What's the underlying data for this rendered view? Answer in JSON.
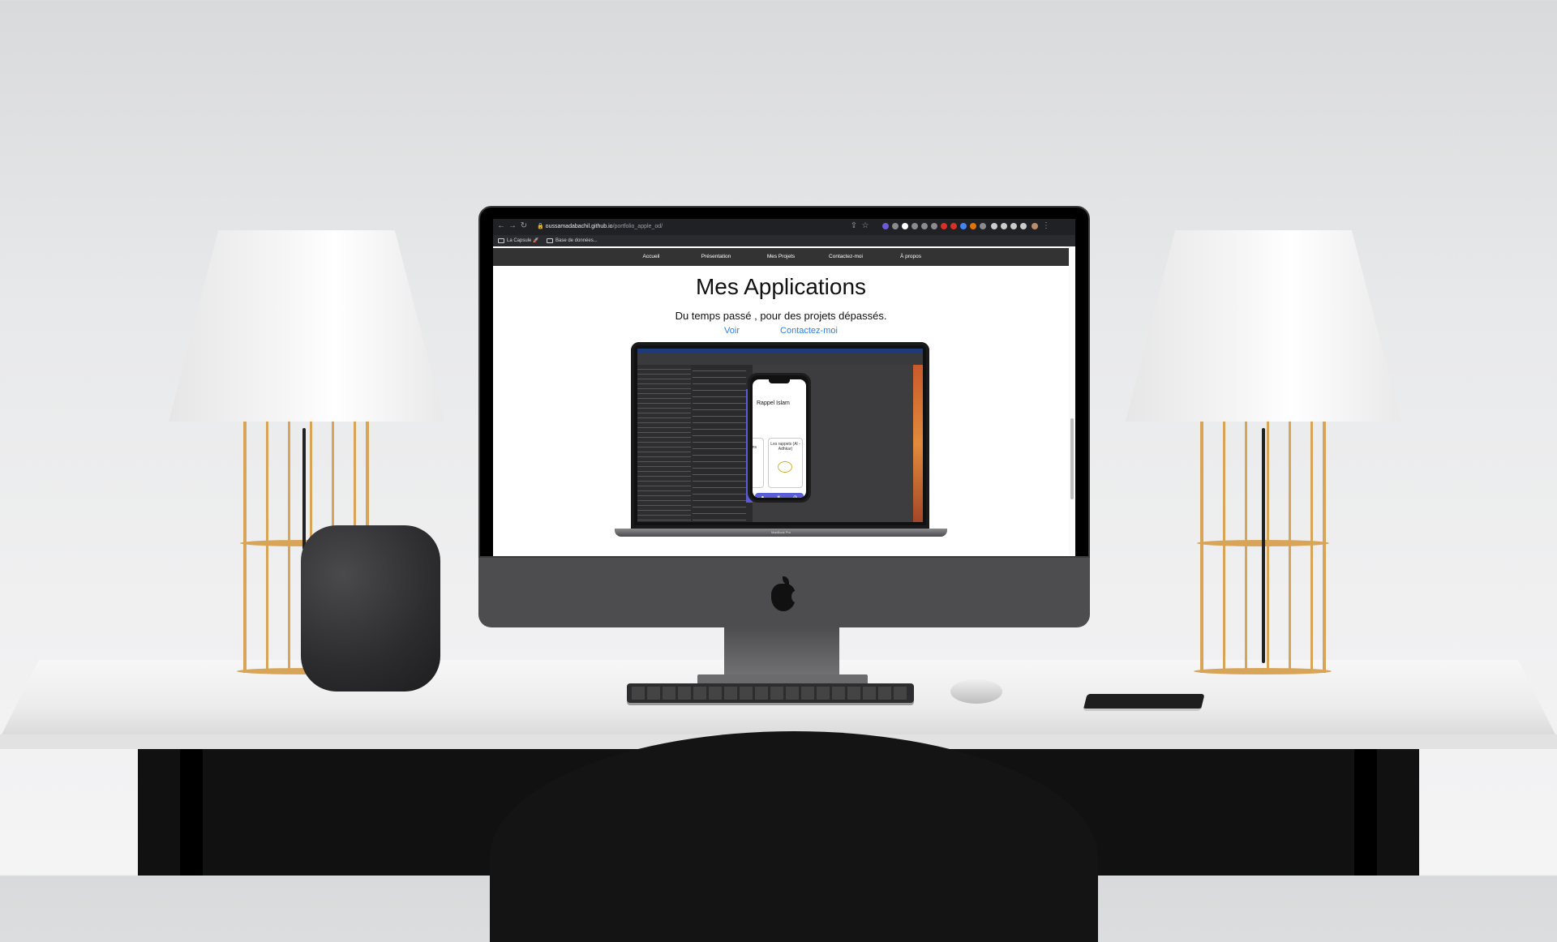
{
  "browser": {
    "url_host": "oussamadabachil.github.io",
    "url_path": "/portfolio_apple_od/",
    "bookmarks": [
      "La Capsule 🚀",
      "Base de données..."
    ]
  },
  "site": {
    "nav": [
      "Accueil",
      "Présentation",
      "Mes Projets",
      "Contactez-moi",
      "À propos"
    ],
    "hero": {
      "title": "Mes Applications",
      "subtitle": "Du temps passé , pour des projets dépassés.",
      "links": [
        "Voir",
        "Contactez-moi"
      ]
    }
  },
  "mockup": {
    "device_label": "MacBook Pro",
    "phone_title": "Rappel Islam",
    "card_text": "Les rappels (Al - Adhkar)",
    "partial_card_text": "ons"
  },
  "colors": {
    "nav_bg": "#333333",
    "link": "#2f80ed",
    "app_accent": "#5a5fd6"
  }
}
